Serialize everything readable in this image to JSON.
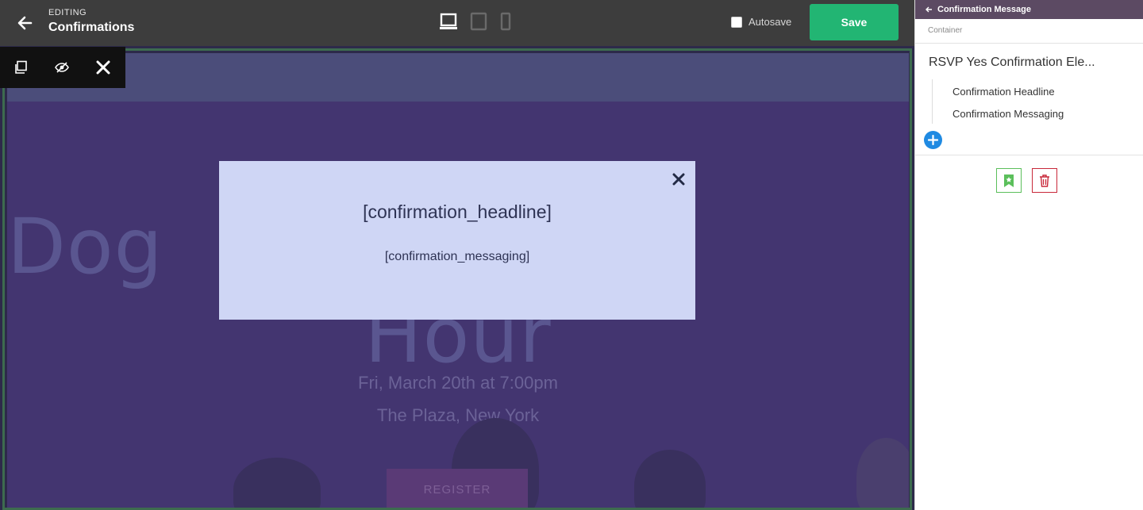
{
  "topbar": {
    "editing_label": "EDITING",
    "page_name": "Confirmations",
    "autosave_label": "Autosave",
    "save_label": "Save"
  },
  "canvas": {
    "hero_title_line1": "Dog                                 appy",
    "hero_title_line2": "Hour",
    "hero_date": "Fri, March 20th at 7:00pm",
    "hero_venue": "The Plaza, New York",
    "register_label": "REGISTER"
  },
  "modal": {
    "headline": "[confirmation_headline]",
    "message": "[confirmation_messaging]"
  },
  "panel": {
    "header_title": "Confirmation Message",
    "subtitle": "Container",
    "element_title": "RSVP Yes Confirmation Ele...",
    "children": [
      {
        "label": "Confirmation Headline"
      },
      {
        "label": "Confirmation Messaging"
      }
    ]
  },
  "colors": {
    "save": "#22b573",
    "panel_header": "#5c4a63",
    "add_button": "#1f8ae2",
    "delete": "#c8283a",
    "modal_bg": "#cfd6f5"
  }
}
